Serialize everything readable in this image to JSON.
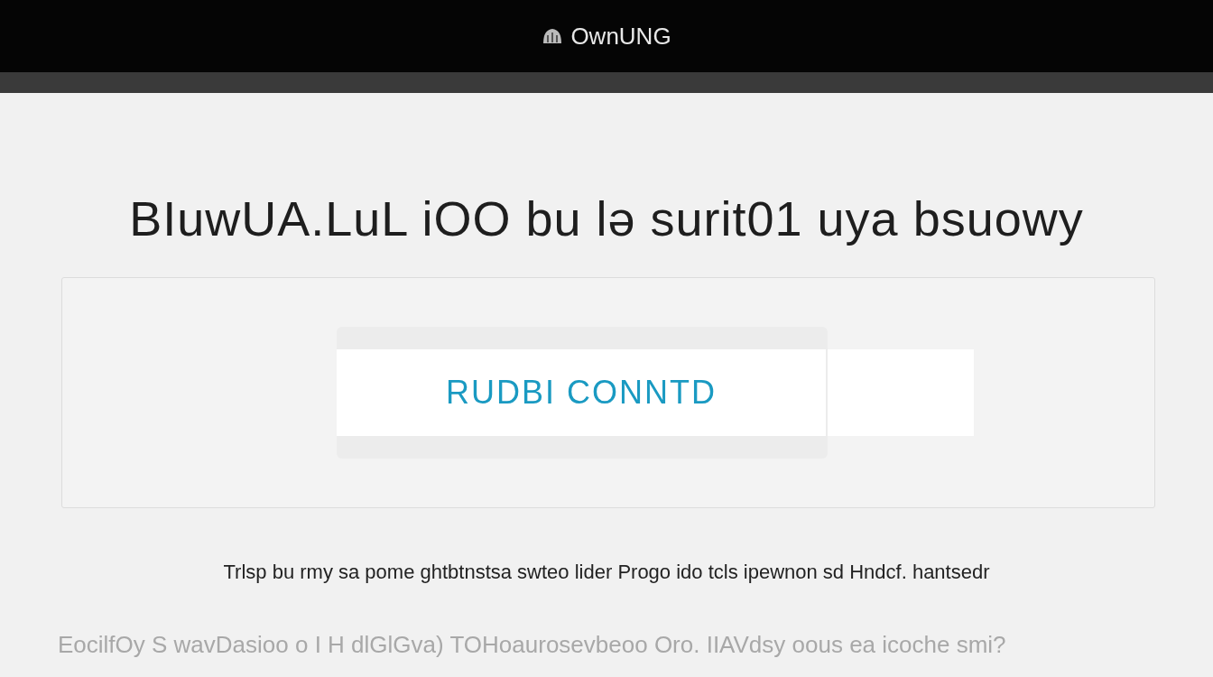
{
  "header": {
    "logo_text": "OwnUNG"
  },
  "heading": "BIuwUA.LuL iOO bu lə surit01 uya bsuowy",
  "action": {
    "button_label": "RUDBI CONNTD"
  },
  "description": "Trlsp bu rmy sa pome ghtbtnstsa swteo lider Progo ido tcls ipewnon sd Hndcf. hantsedr",
  "footer_text": "EocilfOy S wavDasioo o I H dlGlGva) TOHoaurosevbeoo Oro. IIAVdsy oous ea icoche smi?"
}
